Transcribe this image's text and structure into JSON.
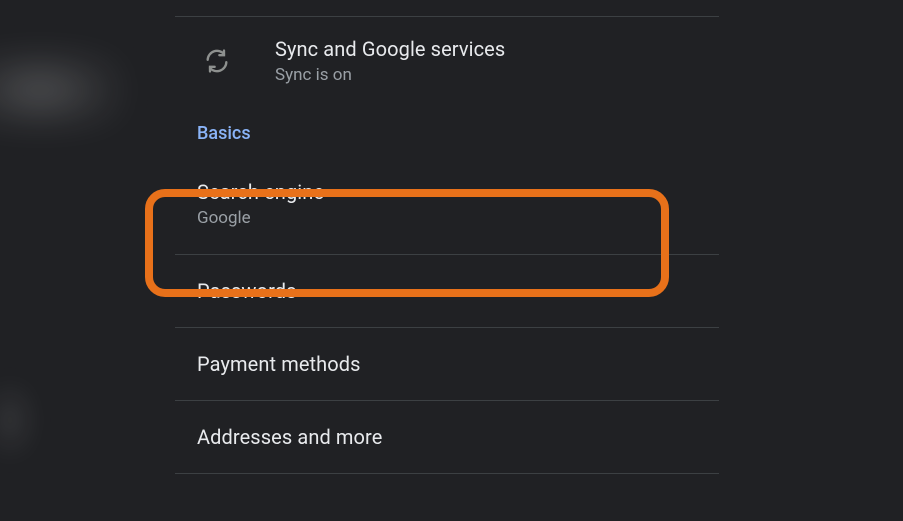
{
  "sync": {
    "title": "Sync and Google services",
    "subtitle": "Sync is on"
  },
  "section_label": "Basics",
  "items": {
    "search_engine": {
      "title": "Search engine",
      "subtitle": "Google"
    },
    "passwords": {
      "title": "Passwords"
    },
    "payment": {
      "title": "Payment methods"
    },
    "addresses": {
      "title": "Addresses and more"
    }
  },
  "colors": {
    "highlight": "#e8711a",
    "accent": "#8ab4f8",
    "background": "#202124"
  }
}
